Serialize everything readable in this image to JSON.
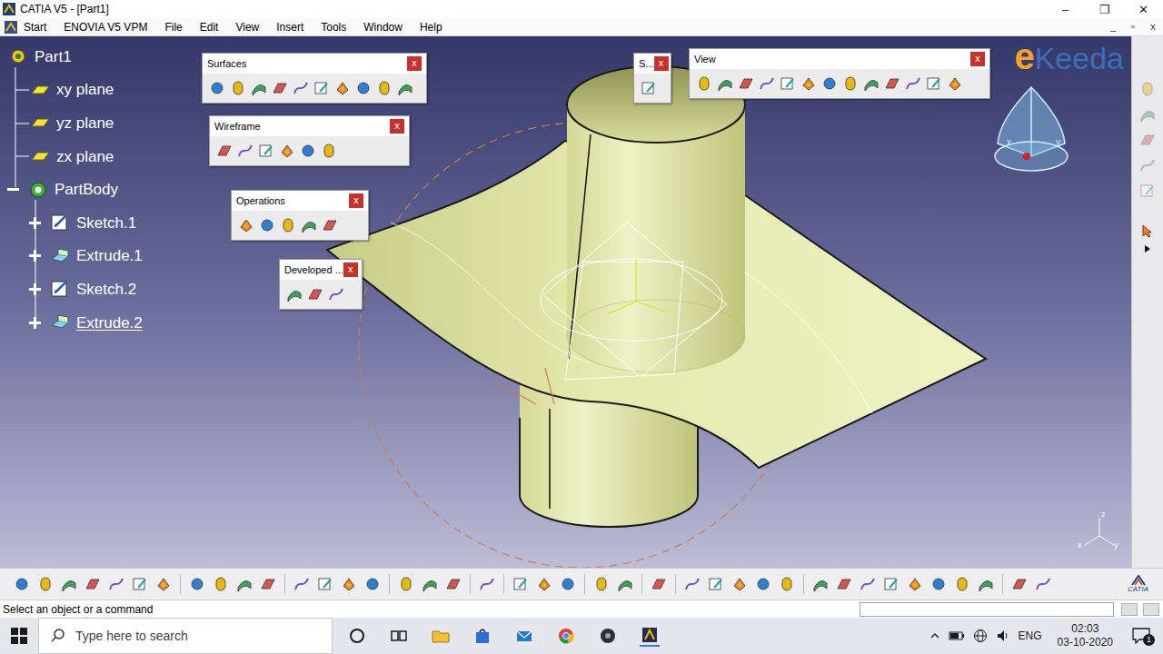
{
  "window": {
    "title": "CATIA V5 - [Part1]",
    "controls": [
      "–",
      "❐",
      "✕"
    ]
  },
  "menu": {
    "items": [
      "Start",
      "ENOVIA V5 VPM",
      "File",
      "Edit",
      "View",
      "Insert",
      "Tools",
      "Window",
      "Help"
    ],
    "controls": [
      "_",
      "▫",
      "x"
    ]
  },
  "tree": [
    {
      "label": "Part1",
      "kind": "root",
      "selected": false
    },
    {
      "label": "xy plane",
      "kind": "plane",
      "selected": false
    },
    {
      "label": "yz plane",
      "kind": "plane",
      "selected": false
    },
    {
      "label": "zx plane",
      "kind": "plane",
      "selected": false
    },
    {
      "label": "PartBody",
      "kind": "body",
      "expanded": true,
      "selected": false
    },
    {
      "label": "Sketch.1",
      "kind": "sketch",
      "expanded": false,
      "selected": false
    },
    {
      "label": "Extrude.1",
      "kind": "extrude",
      "expanded": false,
      "selected": false
    },
    {
      "label": "Sketch.2",
      "kind": "sketch",
      "expanded": false,
      "selected": false
    },
    {
      "label": "Extrude.2",
      "kind": "extrude",
      "expanded": false,
      "selected": true
    }
  ],
  "toolbars": [
    {
      "title": "Surfaces",
      "close": "x",
      "kind": "surfaces"
    },
    {
      "title": "Wireframe",
      "close": "x",
      "kind": "wireframe"
    },
    {
      "title": "Operations",
      "close": "x",
      "kind": "operations"
    },
    {
      "title": "Developed ...",
      "close": "x",
      "kind": "developed"
    },
    {
      "title": "S...",
      "close": "x",
      "kind": "sketcher"
    },
    {
      "title": "View",
      "close": "x",
      "kind": "view"
    }
  ],
  "watermark": {
    "mark": "e",
    "text": "Keeda"
  },
  "compass": {
    "labels": [
      "x",
      "y"
    ]
  },
  "triad": {
    "labels": [
      "z",
      "x",
      "y"
    ]
  },
  "brand": "CATIA",
  "status_bar": {
    "message": "Select an object or a command"
  },
  "taskbar": {
    "search_placeholder": "Type here to search",
    "language": "ENG",
    "time": "02:03",
    "date": "03-10-2020",
    "notifications": "1"
  }
}
